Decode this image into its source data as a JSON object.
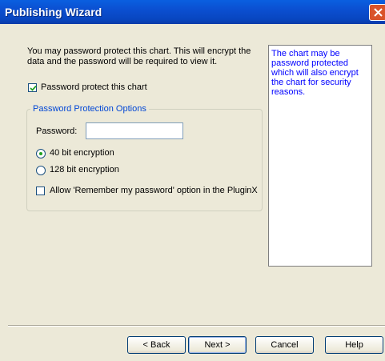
{
  "window": {
    "title": "Publishing Wizard"
  },
  "intro": {
    "line1": "You may password protect this chart.  This will encrypt the",
    "line2": "data and the password will be required to view it."
  },
  "protect": {
    "label": "Password protect this chart",
    "checked": true
  },
  "options": {
    "title": "Password Protection Options",
    "password_label": "Password:",
    "password_value": "",
    "encryption": [
      {
        "label": "40 bit encryption",
        "selected": true
      },
      {
        "label": "128 bit encryption",
        "selected": false
      }
    ],
    "remember_label": "Allow 'Remember my password' option in the PluginX",
    "remember_checked": false
  },
  "help": {
    "text": "The chart may be password protected which will also encrypt the chart for security reasons."
  },
  "buttons": {
    "back": "< Back",
    "next": "Next >",
    "cancel": "Cancel",
    "help": "Help"
  },
  "colors": {
    "titlebar": "#0a54d8",
    "group_title": "#0046d5",
    "help_text": "#0000ff",
    "close": "#d9532a"
  }
}
